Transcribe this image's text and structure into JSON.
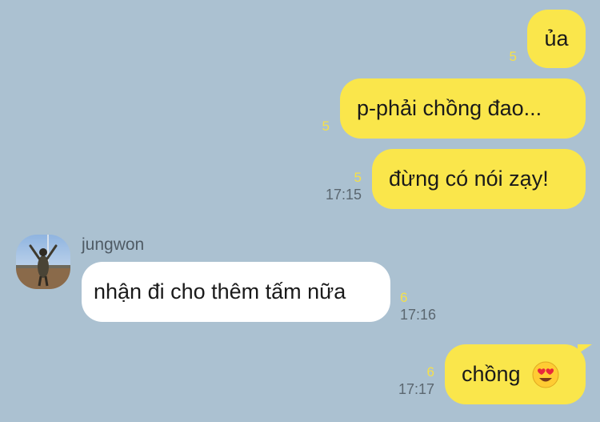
{
  "messages": [
    {
      "text": "ủa",
      "unread": "5"
    },
    {
      "text": "p-phải chồng đao...",
      "unread": "5"
    },
    {
      "text": "đừng có nói zạy!",
      "unread": "5",
      "time": "17:15"
    },
    {
      "sender": "jungwon",
      "text": "nhận đi cho thêm tấm nữa",
      "unread": "6",
      "time": "17:16"
    },
    {
      "text": "chồng",
      "emoji": "heart-eyes-emoji",
      "unread": "6",
      "time": "17:17"
    }
  ],
  "colors": {
    "background": "#abc1d1",
    "my_bubble": "#fae64b",
    "their_bubble": "#ffffff",
    "unread": "#f5e04a"
  }
}
